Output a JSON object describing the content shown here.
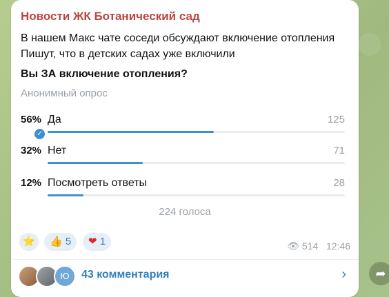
{
  "channel": {
    "name": "Новости ЖК Ботанический сад"
  },
  "message": {
    "line1": "В нашем Макс чате соседи обсуждают включение отопления",
    "line2": "Пишут, что в детских садах уже включили"
  },
  "poll": {
    "question": "Вы ЗА включение отопления?",
    "type": "Анонимный опрос",
    "options": [
      {
        "percent": "56%",
        "label": "Да",
        "count": "125",
        "fraction": 0.56,
        "voted": true
      },
      {
        "percent": "32%",
        "label": "Нет",
        "count": "71",
        "fraction": 0.32,
        "voted": false
      },
      {
        "percent": "12%",
        "label": "Посмотреть ответы",
        "count": "28",
        "fraction": 0.12,
        "voted": false
      }
    ],
    "total": "224 голоса"
  },
  "reactions": [
    {
      "emoji": "⭐",
      "count": ""
    },
    {
      "emoji": "👍",
      "count": "5"
    },
    {
      "emoji": "❤",
      "count": "1"
    }
  ],
  "meta": {
    "views": "514",
    "time": "12:46",
    "views_icon": "eye-icon"
  },
  "comments": {
    "label": "43 комментария",
    "avatar_letter": "Ю"
  },
  "colors": {
    "accent": "#3d8fcf",
    "channel": "#b8463f",
    "link": "#2f7fc2"
  }
}
